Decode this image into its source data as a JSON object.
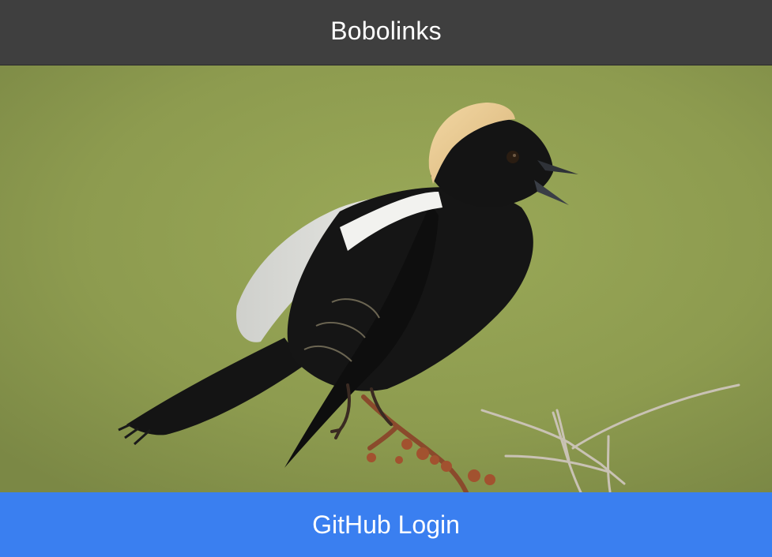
{
  "header": {
    "title": "Bobolinks"
  },
  "hero_image": {
    "subject_icon": "bobolink-bird-photo",
    "background_color": "#8f9d50"
  },
  "footer": {
    "login_label": "GitHub Login",
    "login_color": "#3a7ff0"
  }
}
